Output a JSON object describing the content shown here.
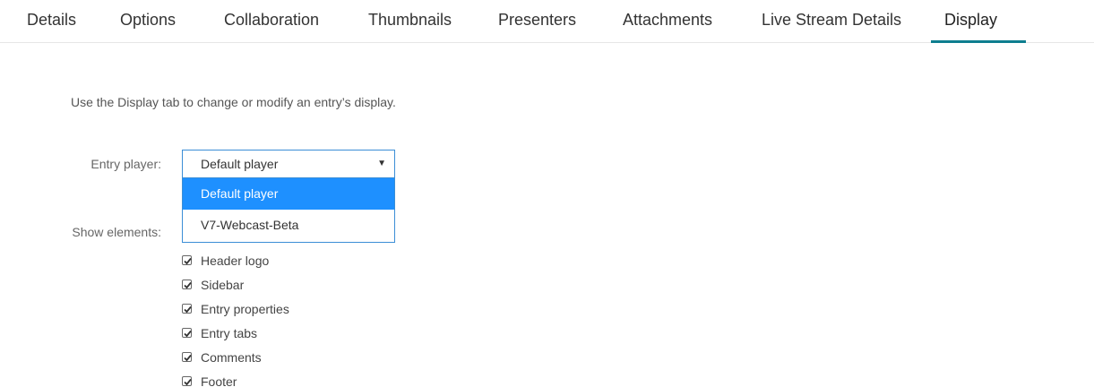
{
  "tabs": [
    {
      "label": "Details"
    },
    {
      "label": "Options"
    },
    {
      "label": "Collaboration"
    },
    {
      "label": "Thumbnails"
    },
    {
      "label": "Presenters"
    },
    {
      "label": "Attachments"
    },
    {
      "label": "Live Stream Details"
    },
    {
      "label": "Display",
      "active": true
    }
  ],
  "intro": "Use the Display tab to change or modify an entry’s display.",
  "entry_player": {
    "label": "Entry player:",
    "selected": "Default player",
    "options": [
      "Default player",
      "V7-Webcast-Beta"
    ],
    "highlighted": "Default player"
  },
  "show_elements": {
    "label": "Show elements:",
    "items": [
      {
        "label": "Header logo",
        "checked": true
      },
      {
        "label": "Sidebar",
        "checked": true
      },
      {
        "label": "Entry properties",
        "checked": true
      },
      {
        "label": "Entry tabs",
        "checked": true
      },
      {
        "label": "Comments",
        "checked": true
      },
      {
        "label": "Footer",
        "checked": true
      }
    ]
  },
  "colors": {
    "accent": "#0d7e8f",
    "select_border": "#3b8ed6",
    "option_highlight": "#1e90ff"
  }
}
